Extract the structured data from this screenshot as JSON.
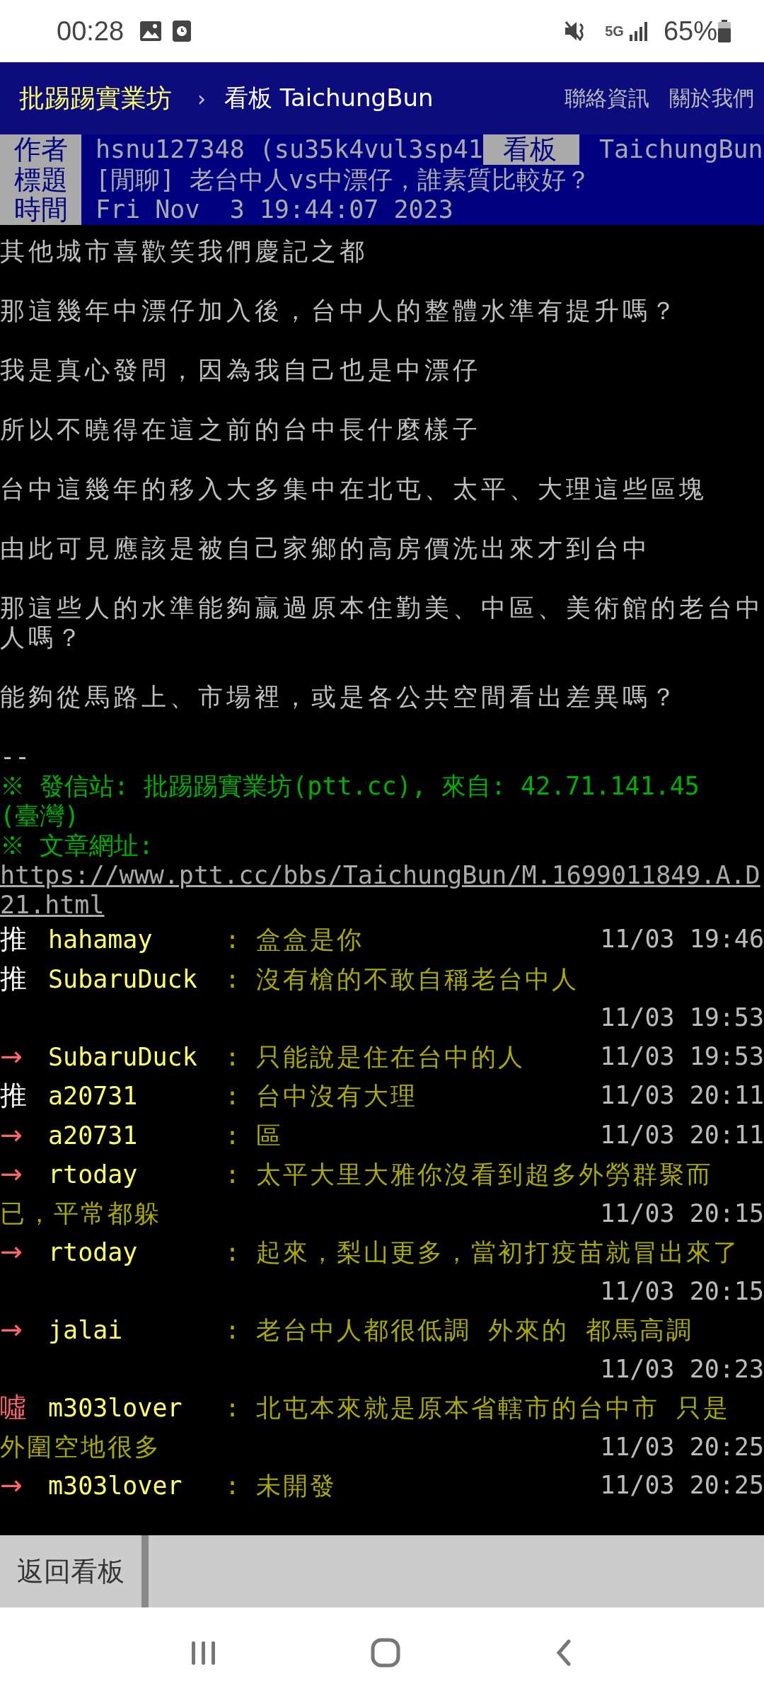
{
  "status_bar": {
    "time": "00:28",
    "network": "5G",
    "battery": "65%"
  },
  "header": {
    "site": "批踢踢實業坊",
    "separator": "›",
    "board": "看板 TaichungBun",
    "links": [
      "聯絡資訊",
      "關於我們"
    ]
  },
  "article_meta": [
    {
      "label": "作者",
      "value": "hsnu127348 (su35k4vul3sp41",
      "side_label": "看板",
      "side_value": "TaichungBun"
    },
    {
      "label": "標題",
      "value": "[閒聊] 老台中人vs中漂仔，誰素質比較好？"
    },
    {
      "label": "時間",
      "value": "Fri Nov  3 19:44:07 2023"
    }
  ],
  "body": [
    "其他城市喜歡笑我們慶記之都",
    "那這幾年中漂仔加入後，台中人的整體水準有提升嗎？",
    "我是真心發問，因為我自己也是中漂仔",
    "所以不曉得在這之前的台中長什麼樣子",
    "台中這幾年的移入大多集中在北屯、太平、大理這些區塊",
    "由此可見應該是被自己家鄉的高房價洗出來才到台中",
    "那這些人的水準能夠贏過原本住勤美、中區、美術館的老台中人嗎？",
    "能夠從馬路上、市場裡，或是各公共空間看出差異嗎？"
  ],
  "signature": {
    "separator": "--",
    "lines": [
      "※ 發信站: 批踢踢實業坊(ptt.cc), 來自: 42.71.141.45 (臺灣)",
      "※ 文章網址:"
    ],
    "url": "https://www.ptt.cc/bbs/TaichungBun/M.1699011849.A.D21.html"
  },
  "comments": [
    {
      "kind": "push",
      "tag": "推",
      "user": "hahamay",
      "separator": ":",
      "content": "盒盒是你",
      "time": "11/03 19:46"
    },
    {
      "kind": "push",
      "tag": "推",
      "user": "SubaruDuck",
      "separator": ":",
      "content": "沒有槍的不敢自稱老台中人",
      "time": "11/03 19:53"
    },
    {
      "kind": "arrow",
      "tag": "→",
      "user": "SubaruDuck",
      "separator": ":",
      "content": "只能說是住在台中的人",
      "time": "11/03 19:53"
    },
    {
      "kind": "push",
      "tag": "推",
      "user": "a20731",
      "separator": ":",
      "content": "台中沒有大理",
      "time": "11/03 20:11"
    },
    {
      "kind": "arrow",
      "tag": "→",
      "user": "a20731",
      "separator": ":",
      "content": "區",
      "time": "11/03 20:11"
    },
    {
      "kind": "arrow",
      "tag": "→",
      "user": "rtoday",
      "separator": ":",
      "content": "太平大里大雅你沒看到超多外勞群聚而",
      "continuation": "已，平常都躲",
      "time": "11/03 20:15"
    },
    {
      "kind": "arrow",
      "tag": "→",
      "user": "rtoday",
      "separator": ":",
      "content": "起來，梨山更多，當初打疫苗就冒出來了",
      "time": "11/03 20:15"
    },
    {
      "kind": "arrow",
      "tag": "→",
      "user": "jalai",
      "separator": ":",
      "content": "老台中人都很低調 外來的 都馬高調",
      "time": "11/03 20:23"
    },
    {
      "kind": "boo",
      "tag": "噓",
      "user": "m303lover",
      "separator": ":",
      "content": "北屯本來就是原本省轄市的台中市 只是",
      "continuation": "外圍空地很多",
      "time": "11/03 20:25"
    },
    {
      "kind": "arrow",
      "tag": "→",
      "user": "m303lover",
      "separator": ":",
      "content": "未開發",
      "time": "11/03 20:25"
    }
  ],
  "bottom_bar": {
    "button": "返回看板"
  }
}
